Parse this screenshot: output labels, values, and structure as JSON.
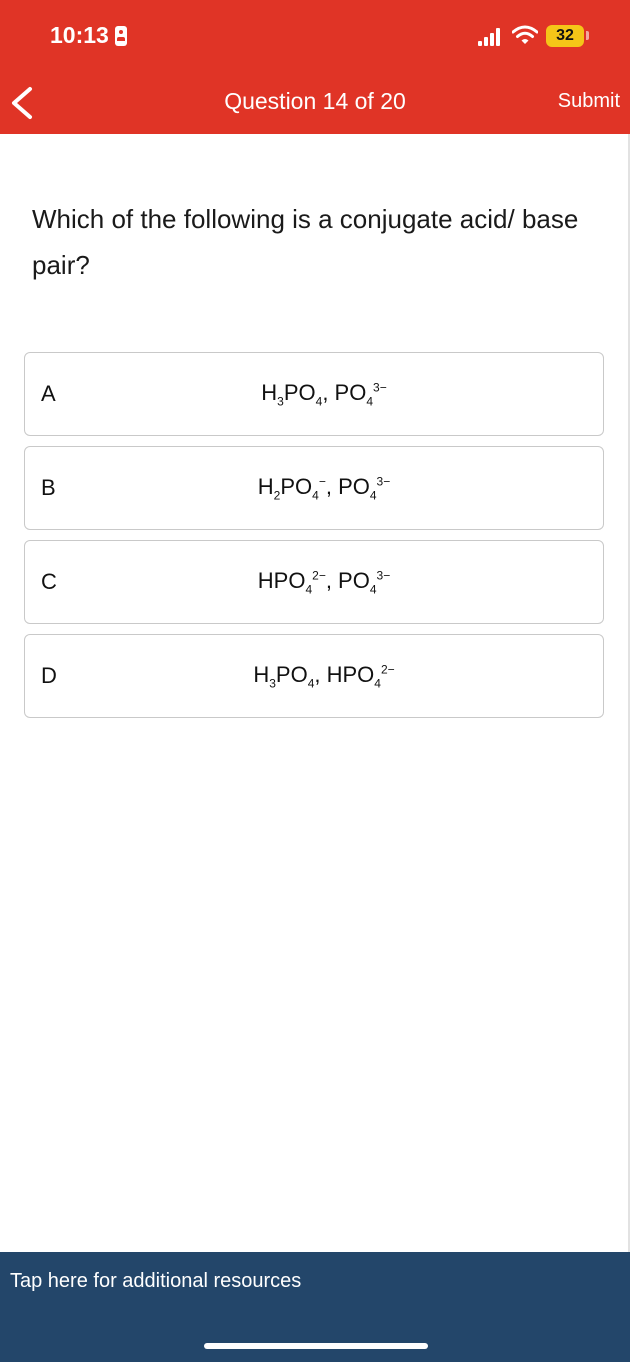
{
  "status": {
    "time": "10:13",
    "battery": "32"
  },
  "nav": {
    "title": "Question 14 of 20",
    "submit_label": "Submit"
  },
  "question": {
    "text": "Which of the following is a conjugate acid/ base pair?"
  },
  "options": [
    {
      "letter": "A",
      "formula_html": "H<sub>3</sub>PO<sub>4</sub>, PO<sub>4</sub><sup>3−</sup>"
    },
    {
      "letter": "B",
      "formula_html": "H<sub>2</sub>PO<sub>4</sub><sup>−</sup>, PO<sub>4</sub><sup>3−</sup>"
    },
    {
      "letter": "C",
      "formula_html": "HPO<sub>4</sub><sup>2−</sup>, PO<sub>4</sub><sup>3−</sup>"
    },
    {
      "letter": "D",
      "formula_html": "H<sub>3</sub>PO<sub>4</sub>, HPO<sub>4</sub><sup>2−</sup>"
    }
  ],
  "footer": {
    "resources_label": "Tap here for additional resources"
  },
  "colors": {
    "header": "#e03426",
    "footer": "#23466a",
    "battery": "#f5c518"
  },
  "icons": [
    "back-chevron-icon",
    "id-card-icon",
    "signal-icon",
    "wifi-icon",
    "battery-icon"
  ]
}
